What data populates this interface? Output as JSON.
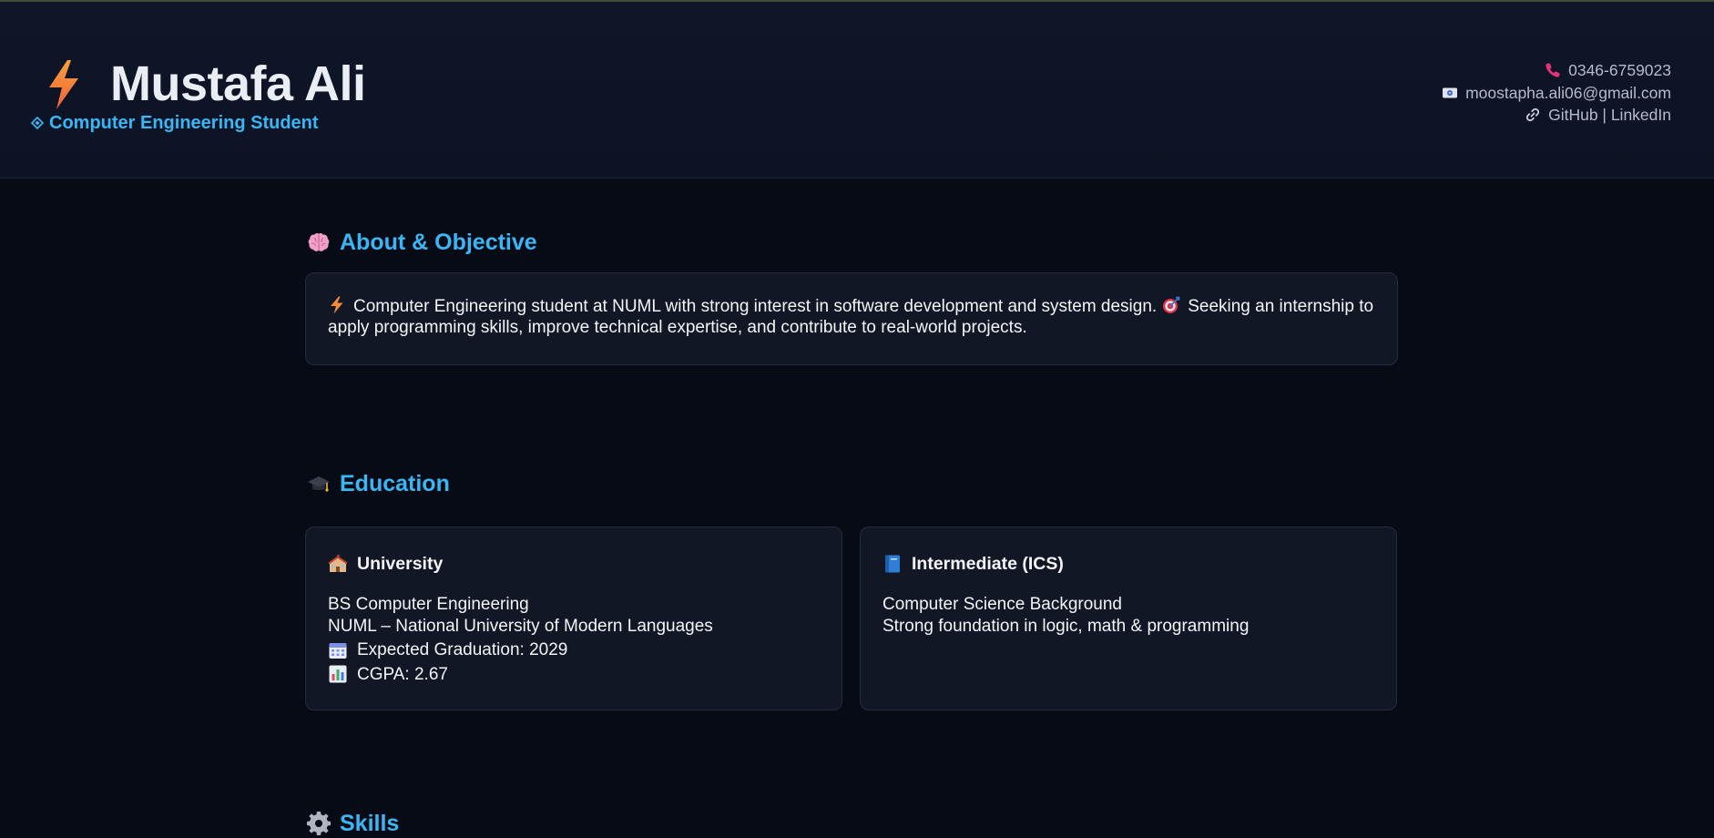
{
  "header": {
    "name": "Mustafa Ali",
    "subtitle": "Computer Engineering Student",
    "contact": {
      "phone": "0346-6759023",
      "email": "moostapha.ali06@gmail.com",
      "links": "GitHub | LinkedIn"
    }
  },
  "sections": {
    "about": {
      "title": "About & Objective",
      "text_part1": "Computer Engineering student at NUML with strong interest in software development and system design.",
      "text_part2": "Seeking an internship to apply programming skills, improve technical expertise, and contribute to real-world projects."
    },
    "education": {
      "title": "Education",
      "university": {
        "heading": "University",
        "degree": "BS Computer Engineering",
        "institution": "NUML – National University of Modern Languages",
        "graduation": "Expected Graduation: 2029",
        "cgpa": "CGPA: 2.67"
      },
      "intermediate": {
        "heading": "Intermediate (ICS)",
        "line1": "Computer Science Background",
        "line2": "Strong foundation in logic, math & programming"
      }
    },
    "skills": {
      "title": "Skills"
    }
  },
  "colors": {
    "accent": "#38b6f5",
    "background": "#060b16",
    "card": "#111725",
    "header": "#0f1628"
  }
}
